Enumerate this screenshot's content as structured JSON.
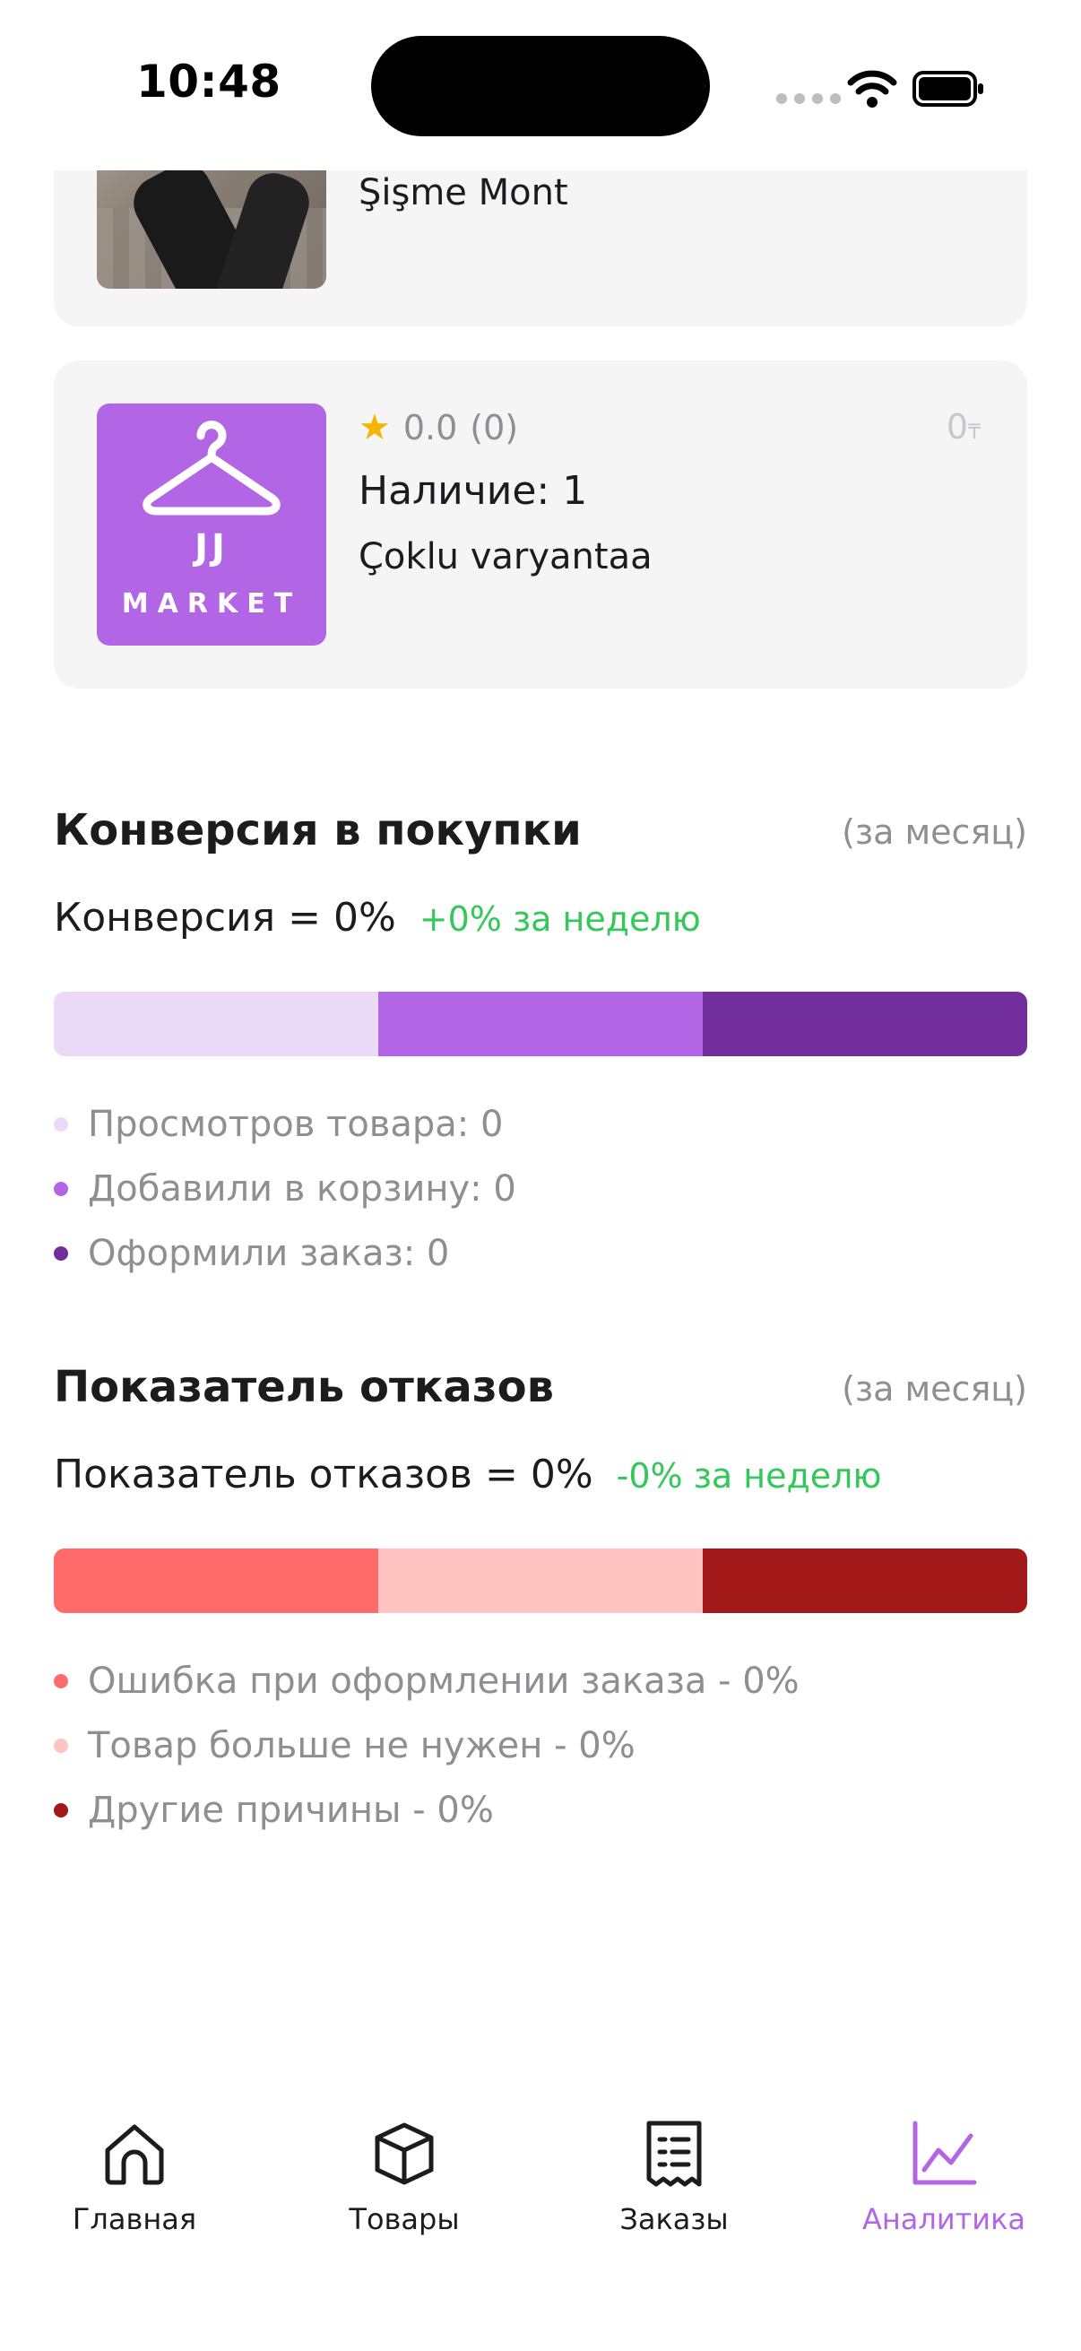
{
  "status_bar": {
    "time": "10:48"
  },
  "products": [
    {
      "title": "Şişme Mont"
    },
    {
      "logo_line1": "JJ",
      "logo_line2": "MARKET",
      "rating": "0.0",
      "reviews": "(0)",
      "price": "0",
      "currency": "₸",
      "stock": "Наличие: 1",
      "variant": "Çoklu varyantaa"
    }
  ],
  "conversion": {
    "title": "Конверсия в покупки",
    "period": "(за месяц)",
    "metric": "Конверсия = 0%",
    "delta": "+0% за неделю",
    "colors": [
      "#ead9f7",
      "#b266e6",
      "#722f9b"
    ],
    "legend": [
      "Просмотров товара: 0",
      "Добавили в корзину: 0",
      "Оформили заказ: 0"
    ]
  },
  "refusals": {
    "title": "Показатель отказов",
    "period": "(за месяц)",
    "metric": "Показатель отказов = 0%",
    "delta": "-0% за неделю",
    "colors": [
      "#ff6b6b",
      "#ffc4c2",
      "#a31818"
    ],
    "legend": [
      "Ошибка при оформлении заказа - 0%",
      "Товар больше не нужен - 0%",
      "Другие причины - 0%"
    ]
  },
  "tabbar": {
    "active_color": "#b266e6",
    "items": [
      {
        "label": "Главная",
        "icon": "home-icon"
      },
      {
        "label": "Товары",
        "icon": "box-icon"
      },
      {
        "label": "Заказы",
        "icon": "receipt-icon"
      },
      {
        "label": "Аналитика",
        "icon": "chart-line-icon"
      }
    ]
  }
}
